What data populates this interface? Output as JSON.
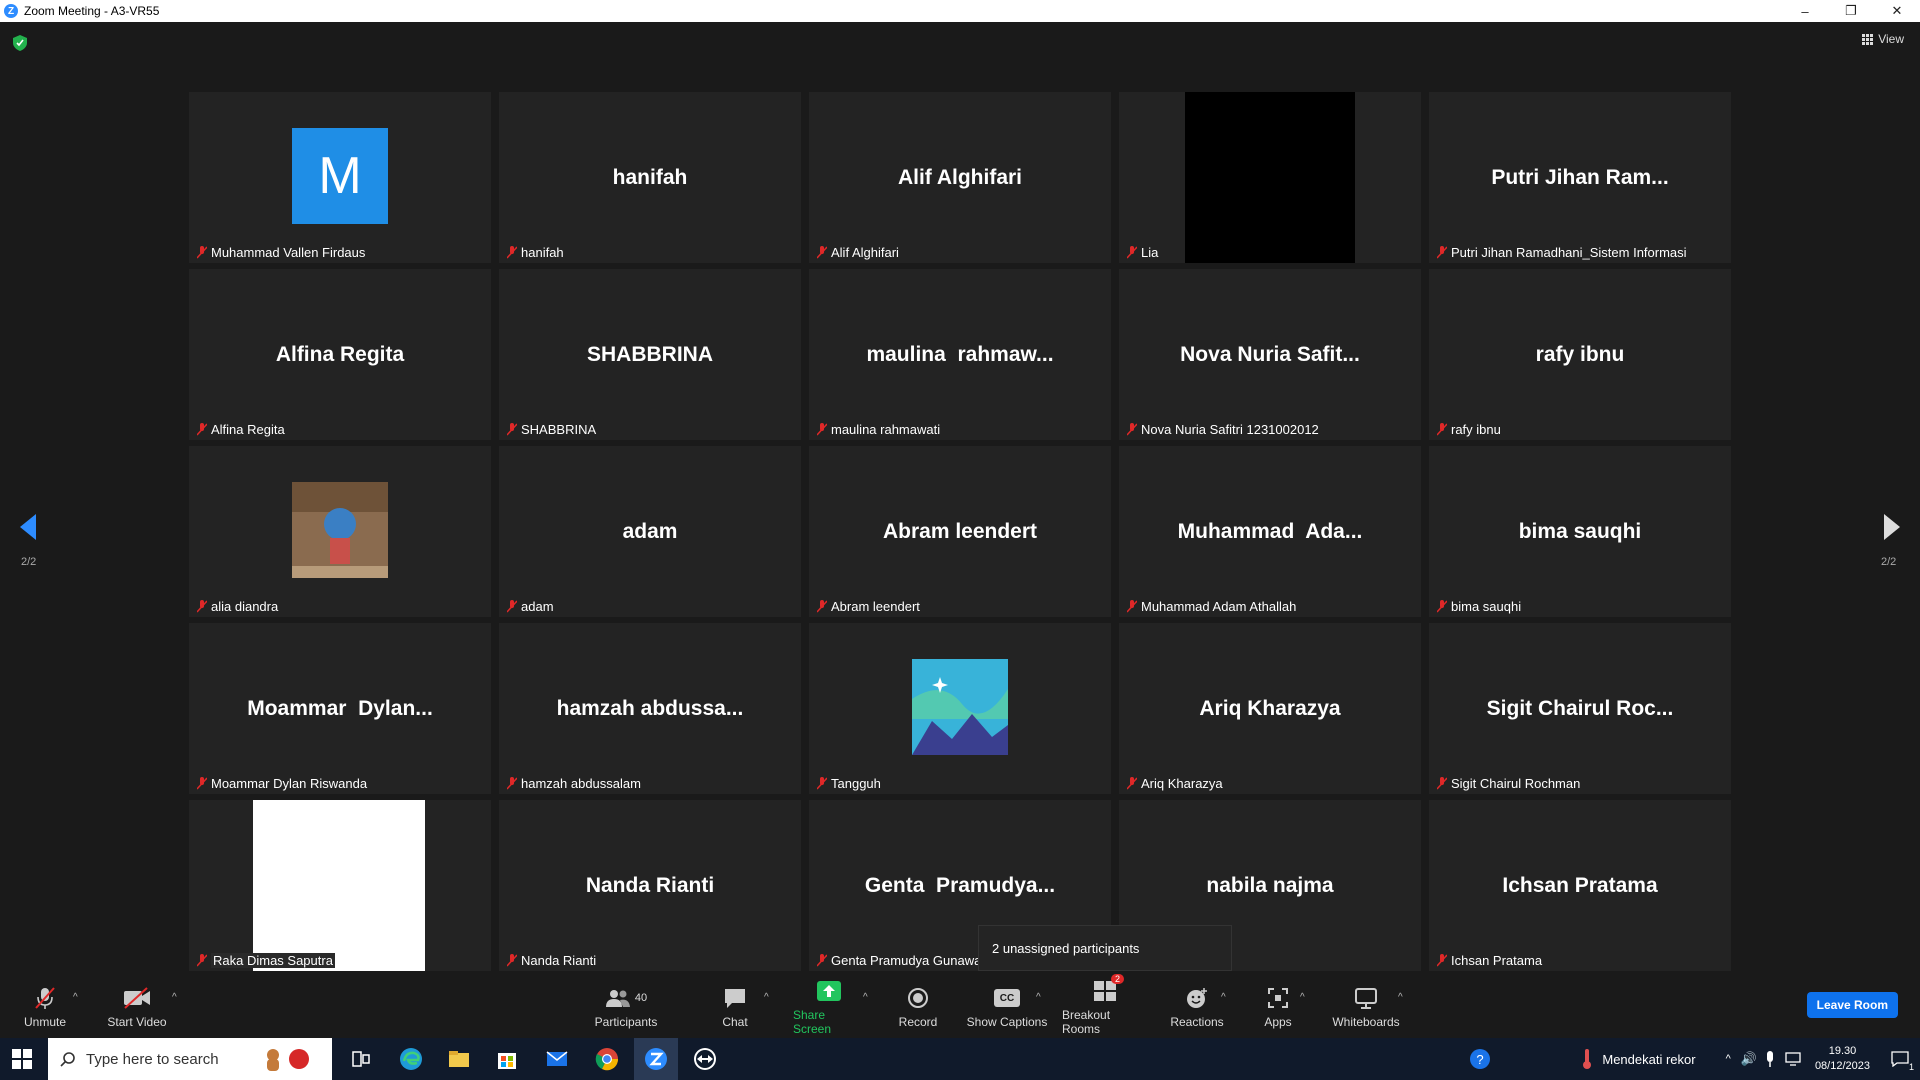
{
  "window": {
    "title": "Zoom Meeting - A3-VR55",
    "minimize": "–",
    "restore": "❐",
    "close": "✕"
  },
  "view_label": "View",
  "page_indicator_left": "2/2",
  "page_indicator_right": "2/2",
  "tiles": [
    {
      "big": "",
      "label": "Muhammad Vallen Firdaus",
      "avatar_letter": "M"
    },
    {
      "big": "hanifah",
      "label": "hanifah"
    },
    {
      "big": "Alif Alghifari",
      "label": "Alif Alghifari"
    },
    {
      "big": "",
      "label": "Lia"
    },
    {
      "big": "Putri Jihan Ram...",
      "label": "Putri Jihan Ramadhani_Sistem Informasi"
    },
    {
      "big": "Alfina Regita",
      "label": "Alfina Regita"
    },
    {
      "big": "SHABBRINA",
      "label": "SHABBRINA"
    },
    {
      "big": "maulina  rahmaw...",
      "label": "maulina rahmawati"
    },
    {
      "big": "Nova Nuria Safit...",
      "label": "Nova Nuria Safitri 1231002012"
    },
    {
      "big": "rafy ibnu",
      "label": "rafy ibnu"
    },
    {
      "big": "",
      "label": "alia diandra"
    },
    {
      "big": "adam",
      "label": "adam"
    },
    {
      "big": "Abram leendert",
      "label": "Abram leendert"
    },
    {
      "big": "Muhammad  Ada...",
      "label": "Muhammad Adam Athallah"
    },
    {
      "big": "bima sauqhi",
      "label": "bima sauqhi"
    },
    {
      "big": "Moammar  Dylan...",
      "label": "Moammar Dylan Riswanda"
    },
    {
      "big": "hamzah abdussa...",
      "label": "hamzah abdussalam"
    },
    {
      "big": "",
      "label": "Tangguh"
    },
    {
      "big": "Ariq Kharazya",
      "label": "Ariq Kharazya"
    },
    {
      "big": "Sigit Chairul Roc...",
      "label": "Sigit Chairul Rochman"
    },
    {
      "big": "",
      "label": "Raka Dimas Saputra"
    },
    {
      "big": "Nanda Rianti",
      "label": "Nanda Rianti"
    },
    {
      "big": "Genta  Pramudya...",
      "label": "Genta Pramudya Gunawa"
    },
    {
      "big": "nabila najma",
      "label": ""
    },
    {
      "big": "Ichsan Pratama",
      "label": "Ichsan Pratama"
    }
  ],
  "tooltip": "2 unassigned participants",
  "toolbar": {
    "unmute": "Unmute",
    "start_video": "Start Video",
    "participants": "Participants",
    "participants_count": "40",
    "chat": "Chat",
    "share_screen": "Share Screen",
    "record": "Record",
    "captions": "Show Captions",
    "captions_icon": "CC",
    "breakout": "Breakout Rooms",
    "breakout_badge": "2",
    "reactions": "Reactions",
    "apps": "Apps",
    "whiteboards": "Whiteboards",
    "leave": "Leave Room"
  },
  "taskbar": {
    "search_placeholder": "Type here to search",
    "weather": "Mendekati rekor",
    "time": "19.30",
    "date": "08/12/2023",
    "notif_count": "1"
  },
  "colors": {
    "accent": "#0e72ed",
    "zoom_blue": "#2d8cff",
    "muted_red": "#e02828",
    "share_green": "#22c55e"
  }
}
